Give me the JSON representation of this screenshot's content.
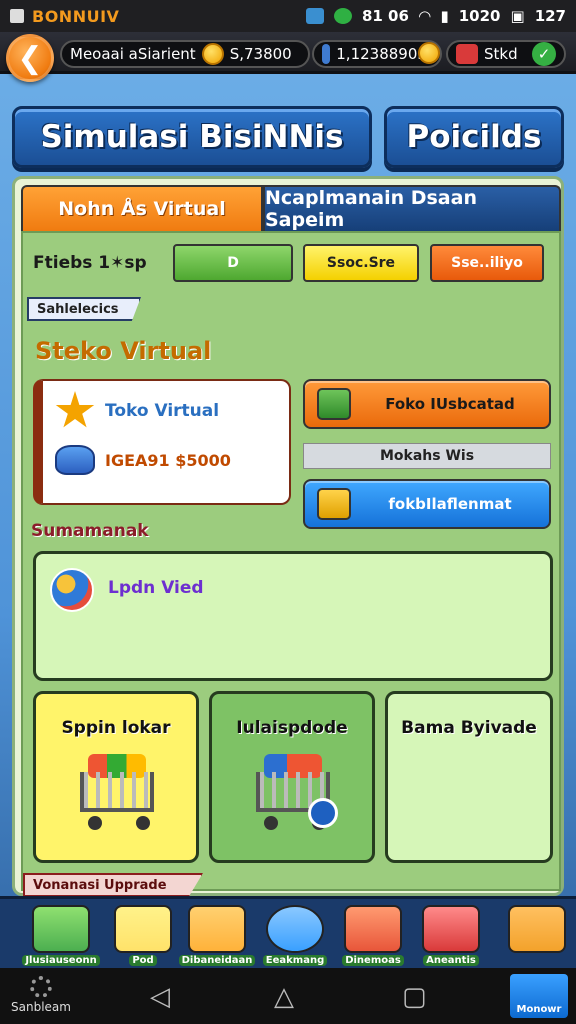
{
  "status_bar": {
    "brand": "BONNUIV",
    "network_text": "81 06",
    "clock": "1020",
    "battery": "127"
  },
  "header": {
    "back_label": "❮",
    "merchant_label": "Meoaai aSiarient",
    "balance": "S,73800",
    "secondary_balance": "1,1238890m",
    "extra_label": "Stkd",
    "check_mark": "✓"
  },
  "titles": {
    "main": "Simulasi BisiNNis",
    "side": "Poicilds"
  },
  "tabs": [
    {
      "label": "Nohn Ås Virtual",
      "active": true
    },
    {
      "label": "Ncaplmanain Dsaan Sapeim",
      "active": false
    }
  ],
  "filter": {
    "label": "Ftiebs 1✶sp",
    "green_label": "D",
    "yellow_label": "Ssoc.Sre",
    "orange_label": "Sse..iliyo"
  },
  "sections": {
    "ribbon_top": "Sahlelecics",
    "store_title": "Steko Virtual",
    "summary_title": "Sumamanak",
    "ribbon_bottom": "Vonanasi Upprade"
  },
  "store_card": {
    "name": "Toko Virtual",
    "value": "IGEA91 $5000"
  },
  "actions": {
    "orange_label": "Foko IUsbcatad",
    "info_label": "Mokahs Wis",
    "blue_label": "fokbIlaflenmat"
  },
  "summary": {
    "text": "Lpdn Vied"
  },
  "tiles": [
    {
      "label": "Sppin lokar"
    },
    {
      "label": "Iulaispdode"
    },
    {
      "label": "Bama Byivade"
    }
  ],
  "bottom_nav": [
    {
      "label": "Jlusiauseonn",
      "color": "#4caf50"
    },
    {
      "label": "Pod",
      "color": "#ffe26a"
    },
    {
      "label": "Dibaneidaan",
      "color": "#ffb23a"
    },
    {
      "label": "Eeakmang",
      "color": "#3aa0ff"
    },
    {
      "label": "Dinemoas",
      "color": "#e8563a"
    },
    {
      "label": "Aneantis",
      "color": "#d93a3a"
    },
    {
      "label": "",
      "color": "#f3a22b"
    }
  ],
  "system_bar": {
    "left_label": "Sanbleam",
    "right_label": "Monowr"
  },
  "colors": {
    "accent_orange": "#f07b10",
    "accent_blue": "#1b4f95",
    "panel_green": "#9ccc7e"
  }
}
